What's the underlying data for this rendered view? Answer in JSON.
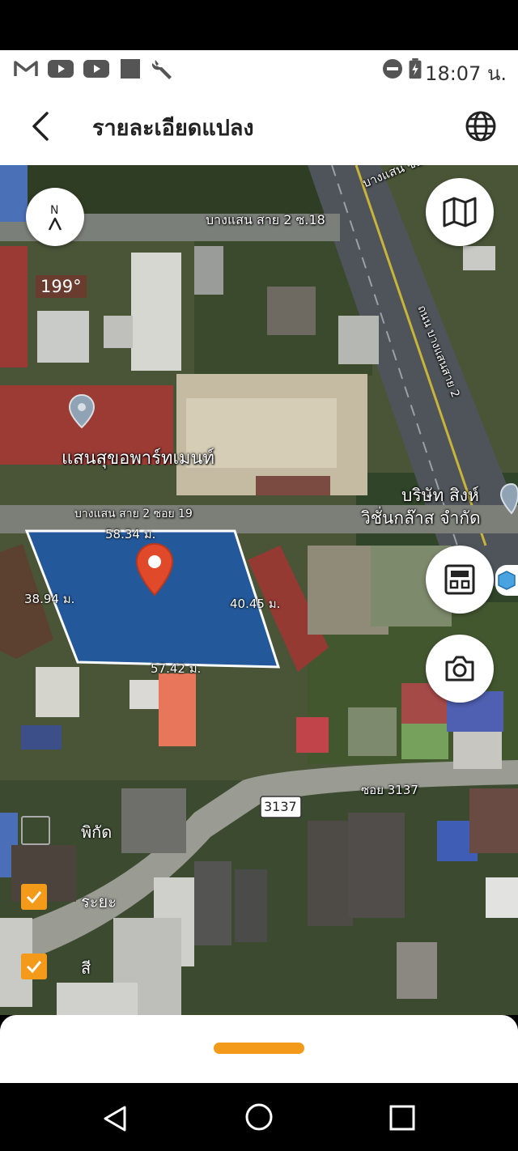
{
  "status_bar": {
    "time": "18:07 น.",
    "left_icons": [
      "gmail-icon",
      "youtube-icon",
      "youtube-icon",
      "square-app-icon",
      "wrench-icon"
    ],
    "right_icons": [
      "do-not-disturb-icon",
      "battery-charging-icon"
    ]
  },
  "header": {
    "title": "รายละเอียดแปลง",
    "back_icon": "chevron-left-icon",
    "language_icon": "globe-icon"
  },
  "map": {
    "compass": {
      "letter": "N",
      "heading": "199°"
    },
    "road_labels": {
      "soi18": "บางแสน สาย 2 ซ.18",
      "top_road": "บางแสน ซอย",
      "main_road": "ถนน บางแสนสาย 2",
      "soi19": "บางแสน สาย 2 ซอย 19",
      "soi3137": "ซอย 3137",
      "route_badge": "3137"
    },
    "places": {
      "apartment": "แสนสุขอพาร์ทเมนท์",
      "company_line1": "บริษัท สิงห์",
      "company_line2": "วิชั่นกล๊าส จำกัด"
    },
    "plot": {
      "top": "58.34 ม.",
      "left": "38.94 ม.",
      "right": "40.45 ม.",
      "bottom": "57.42 ม.",
      "fill_color": "#1e5aa8"
    },
    "buttons": {
      "layers_icon": "map-icon",
      "calculator_icon": "calculator-icon",
      "camera_icon": "camera-icon"
    },
    "legend": [
      {
        "label": "พิกัด",
        "checked": false
      },
      {
        "label": "ระยะ",
        "checked": true
      },
      {
        "label": "สี",
        "checked": true
      }
    ],
    "accent_color": "#f39a1b"
  },
  "nav_bar": {
    "back_icon": "triangle-back-icon",
    "home_icon": "circle-home-icon",
    "recents_icon": "square-recents-icon"
  }
}
